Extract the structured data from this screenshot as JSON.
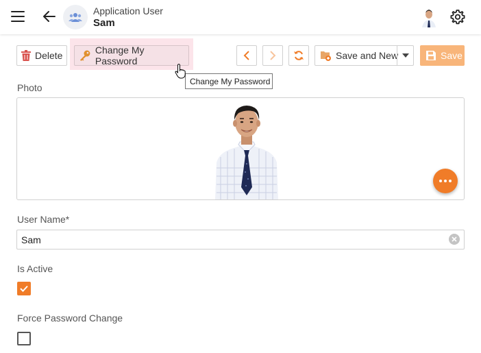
{
  "header": {
    "title": "Application User",
    "subtitle": "Sam",
    "icons": {
      "menu": "hamburger-icon",
      "back": "back-arrow-icon",
      "app": "users-icon",
      "avatar": "user-avatar",
      "settings": "gear-icon"
    }
  },
  "toolbar": {
    "delete_label": "Delete",
    "change_password_label": "Change My Password",
    "save_and_new_label": "Save and New",
    "save_label": "Save",
    "tooltip": "Change My Password",
    "save_disabled": true
  },
  "form": {
    "photo_label": "Photo",
    "username_label": "User Name*",
    "username_value": "Sam",
    "is_active_label": "Is Active",
    "is_active_checked": true,
    "force_password_label": "Force Password Change",
    "force_password_checked": false
  },
  "colors": {
    "accent": "#f07c28",
    "save_disabled": "#f8b57a",
    "delete_icon": "#d9534f",
    "hover_highlight": "#fce4ea"
  }
}
